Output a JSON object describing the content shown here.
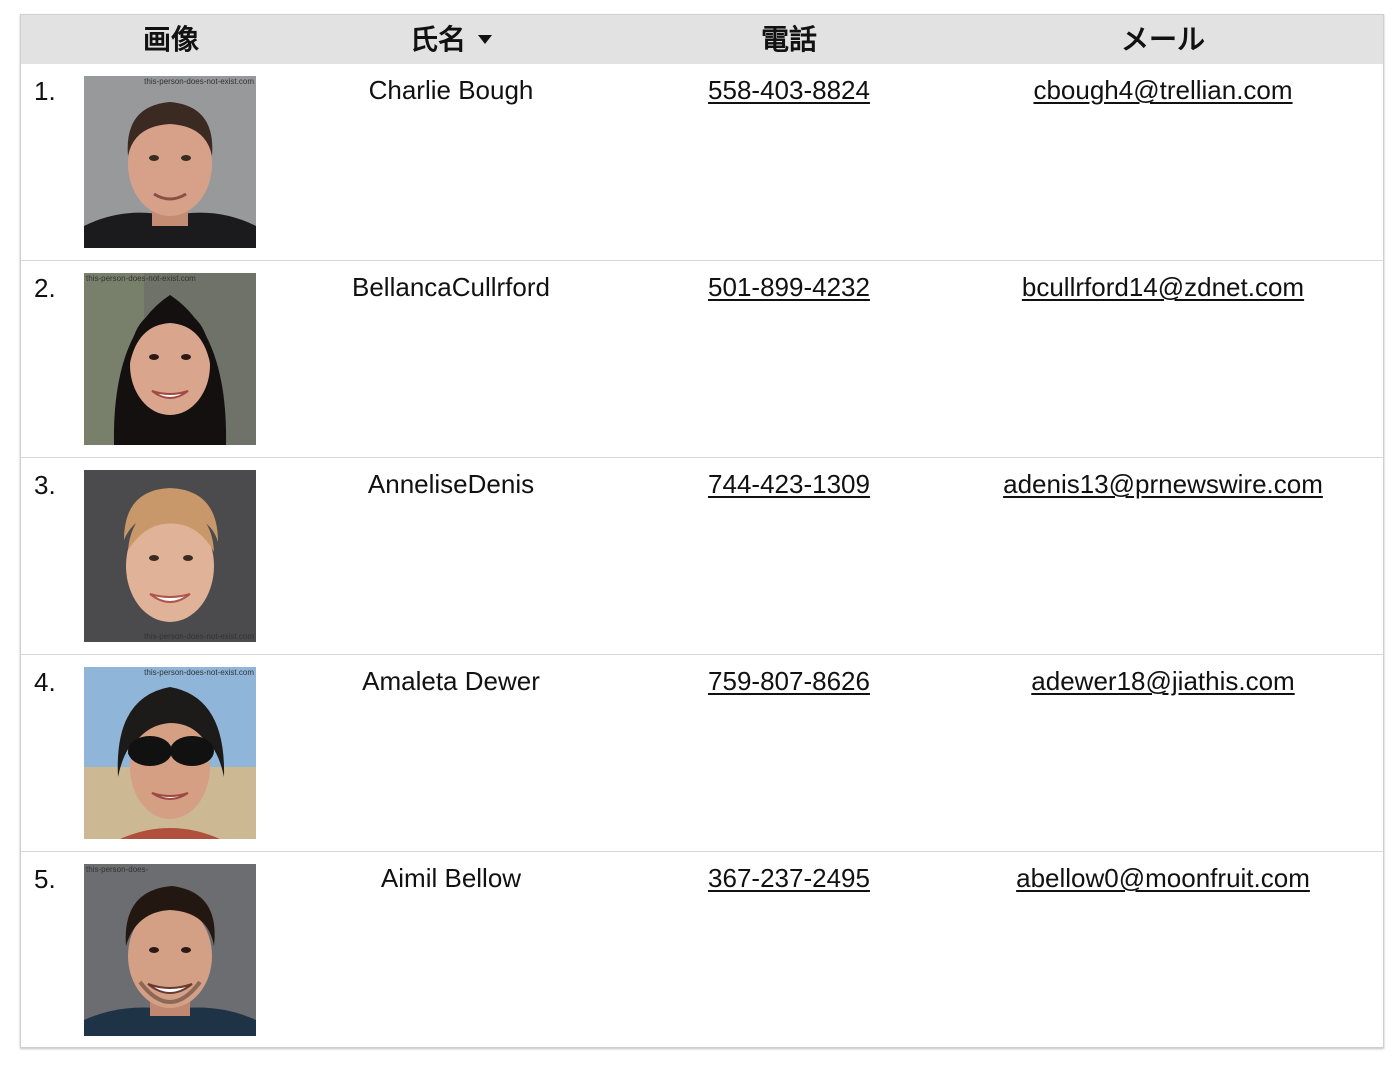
{
  "header": {
    "image": "画像",
    "name": "氏名",
    "phone": "電話",
    "email": "メール"
  },
  "rows": [
    {
      "num": "1.",
      "name": "Charlie Bough",
      "phone": "558-403-8824",
      "email": "cbough4@trellian.com",
      "watermark": "this-person-does-not-exist.com"
    },
    {
      "num": "2.",
      "name": "BellancaCullrford",
      "phone": "501-899-4232",
      "email": "bcullrford14@zdnet.com",
      "watermark": "this-person-does-not-exist.com"
    },
    {
      "num": "3.",
      "name": "AnneliseDenis",
      "phone": "744-423-1309",
      "email": "adenis13@prnewswire.com",
      "watermark": "this-person-does-not-exist.com"
    },
    {
      "num": "4.",
      "name": "Amaleta Dewer",
      "phone": "759-807-8626",
      "email": "adewer18@jiathis.com",
      "watermark": "this-person-does-not-exist.com"
    },
    {
      "num": "5.",
      "name": "Aimil Bellow",
      "phone": "367-237-2495",
      "email": "abellow0@moonfruit.com",
      "watermark": "this-person-does-"
    }
  ]
}
